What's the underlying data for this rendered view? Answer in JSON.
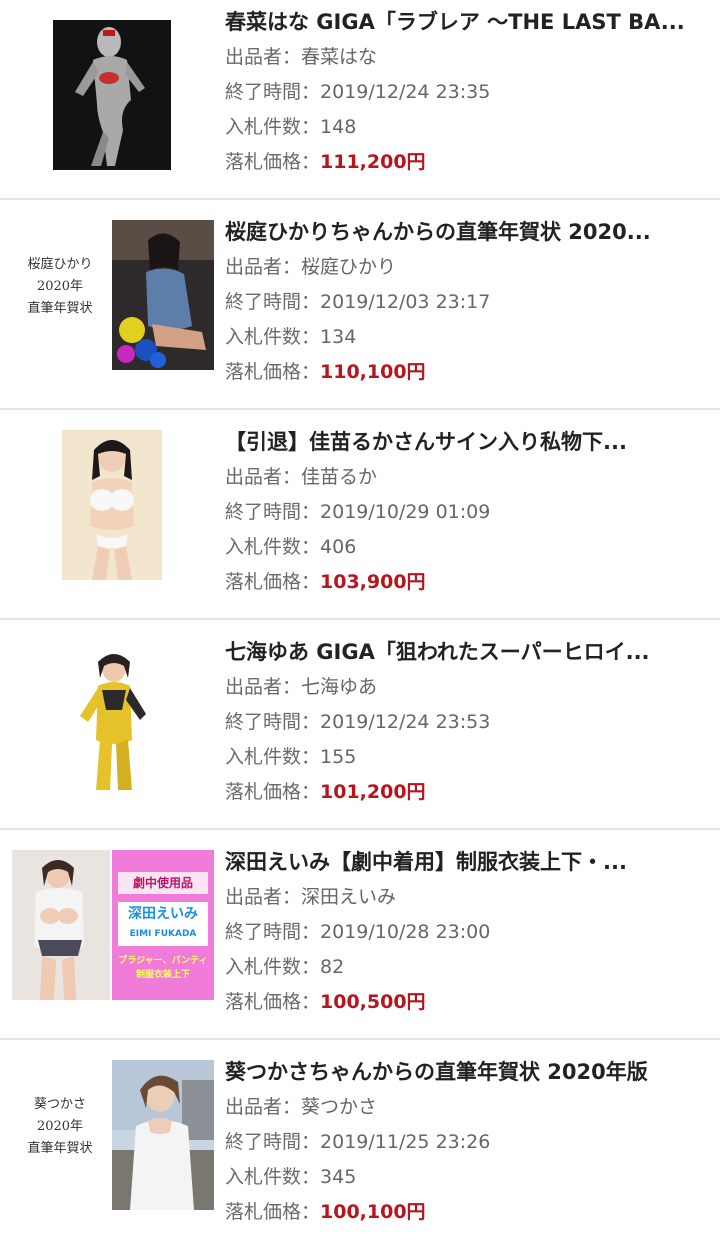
{
  "labels": {
    "seller": "出品者：",
    "end_time": "終了時間：",
    "bids": "入札件数：",
    "price": "落札価格："
  },
  "items": [
    {
      "title": "春菜はな GIGA「ラブレア 〜THE LAST BA...",
      "seller": "春菜はな",
      "end_time": "2019/12/24 23:35",
      "bids": "148",
      "price": "111,200円"
    },
    {
      "title": "桜庭ひかりちゃんからの直筆年賀状 2020...",
      "seller": "桜庭ひかり",
      "end_time": "2019/12/03 23:17",
      "bids": "134",
      "price": "110,100円",
      "card_text": [
        "桜庭ひかり",
        "2020年",
        "直筆年賀状"
      ]
    },
    {
      "title": "【引退】佳苗るかさんサイン入り私物下...",
      "seller": "佳苗るか",
      "end_time": "2019/10/29 01:09",
      "bids": "406",
      "price": "103,900円"
    },
    {
      "title": "七海ゆあ GIGA「狙われたスーパーヒロイ...",
      "seller": "七海ゆあ",
      "end_time": "2019/12/24 23:53",
      "bids": "155",
      "price": "101,200円"
    },
    {
      "title": "深田えいみ【劇中着用】制服衣装上下・...",
      "seller": "深田えいみ",
      "end_time": "2019/10/28 23:00",
      "bids": "82",
      "price": "100,500円",
      "banner_text": [
        "劇中使用品",
        "深田えいみ",
        "EIMI FUKADA",
        "ブラジャー、パンティ",
        "制服衣装上下"
      ]
    },
    {
      "title": "葵つかさちゃんからの直筆年賀状 2020年版",
      "seller": "葵つかさ",
      "end_time": "2019/11/25 23:26",
      "bids": "345",
      "price": "100,100円",
      "card_text": [
        "葵つかさ",
        "2020年",
        "直筆年賀状"
      ]
    }
  ],
  "colors": {
    "price": "#b8141e",
    "divider": "#e4e4e4"
  }
}
